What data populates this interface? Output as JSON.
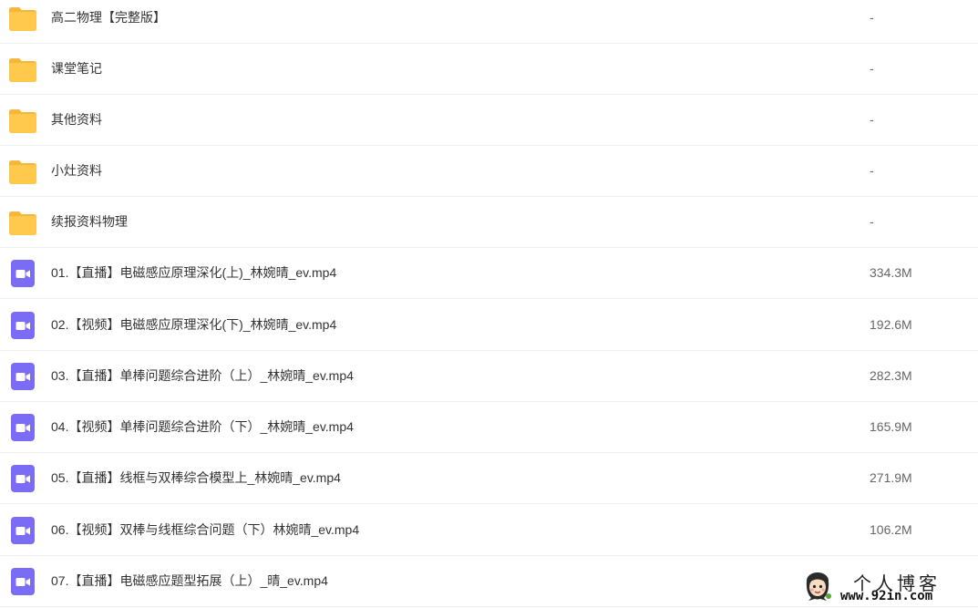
{
  "rows": [
    {
      "type": "folder",
      "icon": "folder-icon",
      "name": "高二物理【完整版】",
      "size": "-"
    },
    {
      "type": "folder",
      "icon": "folder-icon",
      "name": "课堂笔记",
      "size": "-"
    },
    {
      "type": "folder",
      "icon": "folder-icon",
      "name": "其他资料",
      "size": "-"
    },
    {
      "type": "folder",
      "icon": "folder-icon",
      "name": "小灶资料",
      "size": "-"
    },
    {
      "type": "folder",
      "icon": "folder-icon",
      "name": "续报资料物理",
      "size": "-"
    },
    {
      "type": "video",
      "icon": "video-file-icon",
      "name": "01.【直播】电磁感应原理深化(上)_林婉晴_ev.mp4",
      "size": "334.3M"
    },
    {
      "type": "video",
      "icon": "video-file-icon",
      "name": "02.【视频】电磁感应原理深化(下)_林婉晴_ev.mp4",
      "size": "192.6M"
    },
    {
      "type": "video",
      "icon": "video-file-icon",
      "name": "03.【直播】单棒问题综合进阶（上）_林婉晴_ev.mp4",
      "size": "282.3M"
    },
    {
      "type": "video",
      "icon": "video-file-icon",
      "name": "04.【视频】单棒问题综合进阶（下）_林婉晴_ev.mp4",
      "size": "165.9M"
    },
    {
      "type": "video",
      "icon": "video-file-icon",
      "name": "05.【直播】线框与双棒综合模型上_林婉晴_ev.mp4",
      "size": "271.9M"
    },
    {
      "type": "video",
      "icon": "video-file-icon",
      "name": "06.【视频】双棒与线框综合问题（下）林婉晴_ev.mp4",
      "size": "106.2M"
    },
    {
      "type": "video",
      "icon": "video-file-icon",
      "name": "07.【直播】电磁感应题型拓展（上）_晴_ev.mp4",
      "size": ""
    }
  ],
  "watermark": {
    "title": "个人博客",
    "url": "www.92in.com"
  },
  "colors": {
    "folder": "#ffc94d",
    "folder_tab": "#f5b73b",
    "video": "#7b6cf6",
    "divider": "#eef0f3",
    "text": "#333333",
    "size_text": "#666666"
  }
}
